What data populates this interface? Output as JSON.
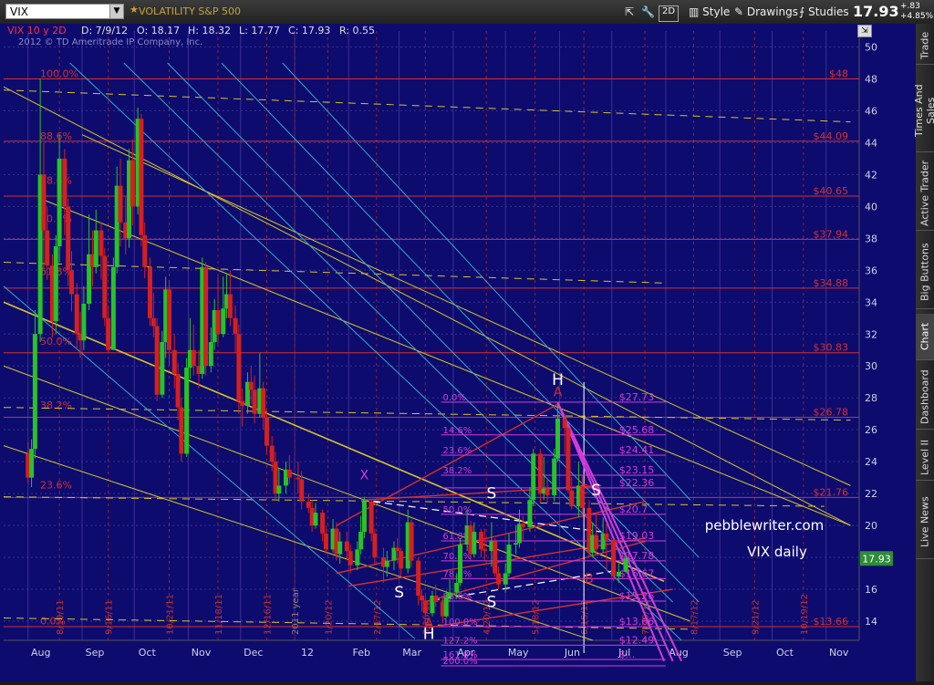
{
  "header": {
    "symbol": "VIX",
    "description": "VOLATILITY S&P 500",
    "style_label": "Style",
    "drawings_label": "Drawings",
    "studies_label": "Studies",
    "mode_label": "2D",
    "last_price": "17.93",
    "change_abs": "+.83",
    "change_pct": "+4.85%"
  },
  "infobar": {
    "symbol_period": "VIX 10 y 2D",
    "date": "D: 7/9/12",
    "open": "O: 18.17",
    "high": "H: 18.32",
    "low": "L: 17.77",
    "close": "C: 17.93",
    "range": "R: 0.55",
    "copyright": "2012 © TD Ameritrade IP Company, Inc."
  },
  "side_tabs": [
    "Trade",
    "Times And Sales",
    "Active Trader",
    "Big Buttons",
    "Chart",
    "Dashboard",
    "Level II",
    "Live News"
  ],
  "active_tab": "Chart",
  "chart_data": {
    "type": "candlestick",
    "title": "VIX daily",
    "watermark": "pebblewriter.com",
    "ylim": [
      12.8,
      51
    ],
    "y_ticks": [
      14,
      16,
      18,
      20,
      22,
      24,
      26,
      28,
      30,
      32,
      34,
      36,
      38,
      40,
      42,
      44,
      46,
      48,
      50
    ],
    "last_value": 17.93,
    "x_month_labels": [
      "Aug",
      "Sep",
      "Oct",
      "Nov",
      "Dec",
      "12",
      "Feb",
      "Mar",
      "Apr",
      "May",
      "Jun",
      "Jul",
      "Aug",
      "Sep",
      "Oct",
      "Nov"
    ],
    "x_date_labels": [
      "8/19/11",
      "9/16/11",
      "10/21/11",
      "11/18/11",
      "12/16/11",
      "2011 year",
      "1/20/12",
      "2/17/12",
      "3/16/12",
      "4/20/12",
      "5/18/12",
      "6/15/12",
      "7/20/12",
      "8/17/12",
      "9/21/12",
      "10/19/12"
    ],
    "price_levels_left": [
      {
        "label": "$48",
        "value": 48
      },
      {
        "label": "$44.09",
        "value": 44.09
      },
      {
        "label": "$40.65",
        "value": 40.65
      },
      {
        "label": "$37.94",
        "value": 37.94
      },
      {
        "label": "$34.88",
        "value": 34.88
      },
      {
        "label": "$30.83",
        "value": 30.83
      },
      {
        "label": "$26.78",
        "value": 26.78
      },
      {
        "label": "$21.76",
        "value": 21.76
      },
      {
        "label": "$13.66",
        "value": 13.66
      }
    ],
    "fib_left_labels": [
      {
        "label": "100.0%",
        "value": 48
      },
      {
        "label": "88.6%",
        "value": 44.09
      },
      {
        "label": "78.6%",
        "value": 41.3
      },
      {
        "label": "70.7%",
        "value": 38.9
      },
      {
        "label": "61.8%",
        "value": 35.6
      },
      {
        "label": "50.0%",
        "value": 31.2
      },
      {
        "label": "38.2%",
        "value": 27.2
      },
      {
        "label": "23.6%",
        "value": 22.2
      },
      {
        "label": "0.0%",
        "value": 13.7
      }
    ],
    "fib_right_levels": [
      {
        "pct": "0.0%",
        "label": "$27.73",
        "value": 27.73
      },
      {
        "pct": "14.6%",
        "label": "$25.68",
        "value": 25.68
      },
      {
        "pct": "23.6%",
        "label": "$24.41",
        "value": 24.41
      },
      {
        "pct": "38.2%",
        "label": "$23.15",
        "value": 23.15
      },
      {
        "pct": "",
        "label": "$22.36",
        "value": 22.36
      },
      {
        "pct": "50.0%",
        "label": "$20.7",
        "value": 20.7
      },
      {
        "pct": "61.8%",
        "label": "$19.03",
        "value": 19.03
      },
      {
        "pct": "70.7%",
        "label": "$17.78",
        "value": 17.78
      },
      {
        "pct": "78.6%",
        "label": "$16.67",
        "value": 16.67
      },
      {
        "pct": "88.6%",
        "label": "$15.26",
        "value": 15.26
      },
      {
        "pct": "100.0%",
        "label": "$13.66",
        "value": 13.66
      },
      {
        "pct": "127.2%",
        "label": "$12.49",
        "value": 12.49
      },
      {
        "pct": "161.8%",
        "label": "$...",
        "value": 11.6
      },
      {
        "pct": "200.0%",
        "label": "",
        "value": 11.2
      }
    ],
    "pattern_labels": [
      {
        "text": "H",
        "x": "2012-05-31",
        "y": 28.8
      },
      {
        "text": "S",
        "x": "2012-04-23",
        "y": 21.7
      },
      {
        "text": "S",
        "x": "2012-06-22",
        "y": 21.9
      },
      {
        "text": "S",
        "x": "2012-03-01",
        "y": 15.5
      },
      {
        "text": "S",
        "x": "2012-04-23",
        "y": 14.9
      },
      {
        "text": "H",
        "x": "2012-03-18",
        "y": 12.9
      }
    ],
    "point_labels": [
      {
        "text": "X",
        "x": "2012-02-10",
        "y": 22.9
      },
      {
        "text": "A",
        "x": "2012-05-31",
        "y": 28.1
      },
      {
        "text": "A",
        "x": "2012-03-18",
        "y": 13.6
      },
      {
        "text": "B",
        "x": "2012-06-18",
        "y": 16.4
      },
      {
        "text": "C",
        "x": "2012-06-15",
        "y": 22.0
      }
    ],
    "candles": [
      [
        "2011-08-01",
        24.5,
        23.0,
        25.2,
        22.6
      ],
      [
        "2011-08-03",
        23.0,
        24.8,
        25.4,
        22.4
      ],
      [
        "2011-08-05",
        24.8,
        32.0,
        33.5,
        24.2
      ],
      [
        "2011-08-08",
        32.0,
        42.0,
        48.0,
        31.5
      ],
      [
        "2011-08-10",
        42.0,
        38.5,
        44.0,
        36.0
      ],
      [
        "2011-08-12",
        38.5,
        36.3,
        40.0,
        35.4
      ],
      [
        "2011-08-15",
        36.3,
        32.8,
        37.0,
        31.8
      ],
      [
        "2011-08-17",
        32.8,
        37.5,
        38.2,
        32.0
      ],
      [
        "2011-08-19",
        37.5,
        43.0,
        44.5,
        36.5
      ],
      [
        "2011-08-22",
        43.0,
        40.0,
        43.6,
        38.2
      ],
      [
        "2011-08-24",
        40.0,
        36.0,
        40.5,
        35.0
      ],
      [
        "2011-08-26",
        36.0,
        34.5,
        37.2,
        33.4
      ],
      [
        "2011-08-29",
        34.5,
        32.0,
        35.2,
        31.0
      ],
      [
        "2011-08-31",
        32.0,
        31.6,
        33.4,
        30.5
      ],
      [
        "2011-09-02",
        31.6,
        33.9,
        35.0,
        31.0
      ],
      [
        "2011-09-05",
        33.9,
        37.0,
        39.5,
        33.5
      ],
      [
        "2011-09-07",
        37.0,
        36.2,
        38.5,
        35.0
      ],
      [
        "2011-09-09",
        36.2,
        38.5,
        39.8,
        35.8
      ],
      [
        "2011-09-12",
        38.5,
        36.9,
        39.0,
        35.4
      ],
      [
        "2011-09-14",
        36.9,
        33.0,
        37.4,
        32.5
      ],
      [
        "2011-09-16",
        33.0,
        31.0,
        33.8,
        30.8
      ],
      [
        "2011-09-19",
        31.0,
        36.2,
        36.8,
        31.4
      ],
      [
        "2011-09-21",
        36.2,
        41.3,
        42.5,
        35.8
      ],
      [
        "2011-09-23",
        41.3,
        39.0,
        43.0,
        37.5
      ],
      [
        "2011-09-26",
        39.0,
        38.0,
        40.6,
        37.0
      ],
      [
        "2011-09-28",
        38.0,
        42.9,
        43.6,
        37.4
      ],
      [
        "2011-09-30",
        42.9,
        40.0,
        44.2,
        38.8
      ],
      [
        "2011-10-03",
        40.0,
        45.5,
        46.2,
        39.5
      ],
      [
        "2011-10-05",
        45.5,
        38.2,
        45.8,
        37.5
      ],
      [
        "2011-10-07",
        38.2,
        36.2,
        39.0,
        35.5
      ],
      [
        "2011-10-10",
        36.2,
        33.0,
        36.8,
        32.5
      ],
      [
        "2011-10-12",
        33.0,
        32.5,
        34.6,
        31.8
      ],
      [
        "2011-10-14",
        32.5,
        28.2,
        33.0,
        27.8
      ],
      [
        "2011-10-17",
        28.2,
        31.5,
        32.2,
        28.0
      ],
      [
        "2011-10-19",
        31.5,
        34.8,
        35.6,
        30.5
      ],
      [
        "2011-10-21",
        34.8,
        31.0,
        35.4,
        30.0
      ],
      [
        "2011-10-24",
        31.0,
        29.5,
        32.0,
        28.6
      ],
      [
        "2011-10-26",
        29.5,
        27.4,
        30.2,
        26.6
      ],
      [
        "2011-10-28",
        27.4,
        24.5,
        28.0,
        24.0
      ],
      [
        "2011-10-31",
        24.5,
        29.9,
        30.5,
        24.3
      ],
      [
        "2011-11-02",
        29.9,
        31.0,
        33.0,
        29.2
      ],
      [
        "2011-11-04",
        31.0,
        30.0,
        32.6,
        29.4
      ],
      [
        "2011-11-07",
        30.0,
        29.5,
        31.0,
        28.6
      ],
      [
        "2011-11-09",
        29.5,
        36.2,
        36.8,
        29.2
      ],
      [
        "2011-11-11",
        36.2,
        30.0,
        36.5,
        29.4
      ],
      [
        "2011-11-14",
        30.0,
        31.5,
        32.4,
        29.6
      ],
      [
        "2011-11-16",
        31.5,
        33.5,
        34.2,
        31.0
      ],
      [
        "2011-11-18",
        33.5,
        32.0,
        35.6,
        31.4
      ],
      [
        "2011-11-21",
        32.0,
        33.6,
        35.6,
        31.8
      ],
      [
        "2011-11-23",
        33.6,
        34.5,
        35.8,
        33.0
      ],
      [
        "2011-11-25",
        34.5,
        33.0,
        36.0,
        32.5
      ],
      [
        "2011-11-28",
        33.0,
        32.0,
        33.8,
        30.8
      ],
      [
        "2011-11-30",
        32.0,
        27.8,
        32.6,
        27.0
      ],
      [
        "2011-12-02",
        27.8,
        27.5,
        28.6,
        26.2
      ],
      [
        "2011-12-05",
        27.5,
        29.0,
        29.6,
        27.0
      ],
      [
        "2011-12-07",
        29.0,
        28.5,
        30.0,
        27.6
      ],
      [
        "2011-12-09",
        28.5,
        27.0,
        29.4,
        26.4
      ],
      [
        "2011-12-12",
        27.0,
        28.6,
        30.8,
        26.8
      ],
      [
        "2011-12-14",
        28.6,
        26.8,
        29.0,
        26.0
      ],
      [
        "2011-12-16",
        26.8,
        25.0,
        27.2,
        24.5
      ],
      [
        "2011-12-19",
        25.0,
        24.0,
        25.6,
        23.4
      ],
      [
        "2011-12-21",
        24.0,
        22.0,
        24.6,
        21.6
      ],
      [
        "2011-12-23",
        22.0,
        22.5,
        23.6,
        21.5
      ],
      [
        "2011-12-27",
        22.5,
        23.5,
        24.0,
        22.0
      ],
      [
        "2011-12-29",
        23.5,
        23.0,
        24.4,
        22.6
      ],
      [
        "2012-01-03",
        23.0,
        22.9,
        24.0,
        22.0
      ],
      [
        "2012-01-05",
        22.9,
        21.5,
        23.4,
        21.0
      ],
      [
        "2012-01-09",
        21.5,
        21.1,
        22.0,
        20.8
      ],
      [
        "2012-01-11",
        21.1,
        20.0,
        21.6,
        19.6
      ],
      [
        "2012-01-13",
        20.0,
        20.8,
        21.4,
        19.8
      ],
      [
        "2012-01-17",
        20.8,
        19.5,
        21.0,
        19.0
      ],
      [
        "2012-01-19",
        19.5,
        18.5,
        20.0,
        18.2
      ],
      [
        "2012-01-23",
        18.5,
        19.8,
        20.4,
        18.3
      ],
      [
        "2012-01-25",
        19.8,
        18.2,
        20.2,
        17.8
      ],
      [
        "2012-01-27",
        18.2,
        19.0,
        19.6,
        17.6
      ],
      [
        "2012-01-31",
        19.0,
        18.4,
        19.6,
        17.8
      ],
      [
        "2012-02-02",
        18.4,
        17.5,
        18.8,
        17.0
      ],
      [
        "2012-02-06",
        17.5,
        18.5,
        19.0,
        17.2
      ],
      [
        "2012-02-08",
        18.5,
        19.6,
        20.6,
        18.2
      ],
      [
        "2012-02-10",
        19.6,
        21.5,
        21.8,
        19.2
      ],
      [
        "2012-02-14",
        21.5,
        19.5,
        21.6,
        19.0
      ],
      [
        "2012-02-16",
        19.5,
        18.0,
        19.8,
        17.6
      ],
      [
        "2012-02-21",
        18.0,
        17.4,
        18.6,
        16.4
      ],
      [
        "2012-02-23",
        17.4,
        17.8,
        18.4,
        16.8
      ],
      [
        "2012-02-27",
        17.8,
        18.6,
        19.0,
        17.2
      ],
      [
        "2012-02-29",
        18.6,
        18.4,
        19.2,
        17.6
      ],
      [
        "2012-03-02",
        18.4,
        17.3,
        18.6,
        16.8
      ],
      [
        "2012-03-06",
        17.3,
        20.2,
        21.0,
        17.0
      ],
      [
        "2012-03-08",
        20.2,
        17.8,
        20.4,
        17.4
      ],
      [
        "2012-03-12",
        17.8,
        15.6,
        18.0,
        15.0
      ],
      [
        "2012-03-14",
        15.6,
        15.3,
        16.0,
        14.6
      ],
      [
        "2012-03-16",
        15.3,
        14.5,
        15.6,
        13.7
      ],
      [
        "2012-03-20",
        14.5,
        15.6,
        15.9,
        14.3
      ],
      [
        "2012-03-22",
        15.6,
        15.2,
        16.3,
        14.9
      ],
      [
        "2012-03-26",
        15.2,
        14.3,
        15.6,
        13.9
      ],
      [
        "2012-03-28",
        14.3,
        15.5,
        15.9,
        14.2
      ],
      [
        "2012-03-30",
        15.5,
        15.8,
        16.6,
        15.2
      ],
      [
        "2012-04-03",
        15.8,
        16.4,
        17.0,
        15.4
      ],
      [
        "2012-04-05",
        16.4,
        18.8,
        19.2,
        16.2
      ],
      [
        "2012-04-09",
        18.8,
        20.0,
        21.0,
        18.4
      ],
      [
        "2012-04-11",
        20.0,
        18.2,
        20.3,
        17.8
      ],
      [
        "2012-04-13",
        18.2,
        19.6,
        20.2,
        18.0
      ],
      [
        "2012-04-17",
        19.6,
        18.5,
        19.8,
        18.0
      ],
      [
        "2012-04-19",
        18.5,
        18.4,
        19.8,
        17.8
      ],
      [
        "2012-04-23",
        18.4,
        19.0,
        20.2,
        17.4
      ],
      [
        "2012-04-25",
        19.0,
        17.0,
        19.2,
        16.8
      ],
      [
        "2012-04-27",
        17.0,
        16.3,
        17.4,
        16.0
      ],
      [
        "2012-05-01",
        16.3,
        17.0,
        17.6,
        15.8
      ],
      [
        "2012-05-03",
        17.0,
        18.8,
        19.5,
        16.8
      ],
      [
        "2012-05-07",
        18.8,
        18.9,
        20.0,
        18.2
      ],
      [
        "2012-05-09",
        18.9,
        20.1,
        21.0,
        18.6
      ],
      [
        "2012-05-11",
        20.1,
        19.9,
        20.6,
        19.0
      ],
      [
        "2012-05-15",
        19.9,
        21.6,
        22.4,
        19.6
      ],
      [
        "2012-05-17",
        21.6,
        24.5,
        24.8,
        21.2
      ],
      [
        "2012-05-21",
        24.5,
        22.0,
        24.8,
        21.4
      ],
      [
        "2012-05-23",
        22.0,
        22.3,
        24.3,
        21.6
      ],
      [
        "2012-05-25",
        22.3,
        21.9,
        23.0,
        21.4
      ],
      [
        "2012-05-29",
        21.9,
        24.2,
        24.8,
        21.5
      ],
      [
        "2012-05-31",
        24.2,
        26.7,
        27.7,
        24.0
      ],
      [
        "2012-06-04",
        26.7,
        26.1,
        27.0,
        24.5
      ],
      [
        "2012-06-06",
        26.1,
        22.2,
        26.2,
        22.0
      ],
      [
        "2012-06-08",
        22.2,
        21.2,
        23.0,
        21.0
      ],
      [
        "2012-06-12",
        21.2,
        22.5,
        24.0,
        20.5
      ],
      [
        "2012-06-14",
        22.5,
        21.1,
        23.2,
        20.8
      ],
      [
        "2012-06-18",
        21.1,
        18.3,
        21.6,
        18.0
      ],
      [
        "2012-06-20",
        18.3,
        19.4,
        20.2,
        18.0
      ],
      [
        "2012-06-22",
        19.4,
        18.5,
        20.8,
        18.2
      ],
      [
        "2012-06-26",
        18.5,
        19.5,
        20.5,
        18.3
      ],
      [
        "2012-06-28",
        19.5,
        19.1,
        20.2,
        17.2
      ],
      [
        "2012-07-02",
        19.1,
        16.8,
        19.2,
        16.5
      ],
      [
        "2012-07-05",
        16.8,
        17.1,
        17.6,
        16.4
      ],
      [
        "2012-07-09",
        17.1,
        17.93,
        18.32,
        17.0
      ]
    ]
  },
  "colors": {
    "background": "#0d0b6e",
    "grid": "#3b3094",
    "bull": "#27c327",
    "bear": "#d42020",
    "fib_red": "#d43030",
    "fib_magenta": "#d23cd8",
    "trend_yellow": "#d6c52a",
    "trend_cyan": "#3aa8c9",
    "price_tag": "#2e8b3a"
  }
}
